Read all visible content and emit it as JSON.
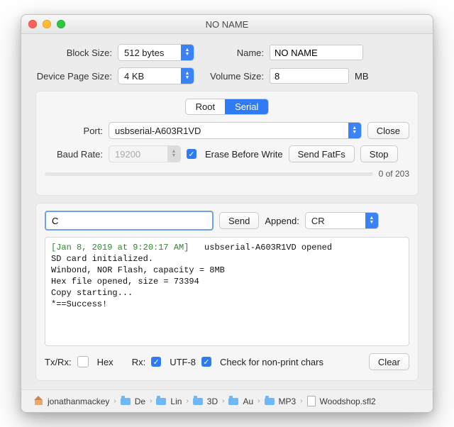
{
  "window": {
    "title": "NO NAME"
  },
  "settings": {
    "block_size_label": "Block Size:",
    "block_size_value": "512 bytes",
    "name_label": "Name:",
    "name_value": "NO NAME",
    "page_size_label": "Device Page Size:",
    "page_size_value": "4 KB",
    "volume_size_label": "Volume Size:",
    "volume_size_value": "8",
    "volume_size_unit": "MB"
  },
  "tabs": {
    "root": "Root",
    "serial": "Serial"
  },
  "port": {
    "label": "Port:",
    "value": "usbserial-A603R1VD",
    "close": "Close"
  },
  "baud": {
    "label": "Baud Rate:",
    "value": "19200",
    "erase_label": "Erase Before Write",
    "send_fatfs": "Send FatFs",
    "stop": "Stop"
  },
  "progress": {
    "text": "0 of 203"
  },
  "cmd": {
    "value": "C",
    "send": "Send",
    "append_label": "Append:",
    "append_value": "CR"
  },
  "log": {
    "timestamp": "[Jan 8, 2019 at 9:20:17 AM]",
    "opened": "usbserial-A603R1VD opened",
    "lines": "SD card initialized.\nWinbond, NOR Flash, capacity = 8MB\nHex file opened, size = 73394\nCopy starting...\n*==Success!"
  },
  "options": {
    "txrx_label": "Tx/Rx:",
    "hex_label": "Hex",
    "rx_label": "Rx:",
    "utf8_label": "UTF-8",
    "nonprint_label": "Check for non-print chars",
    "clear": "Clear"
  },
  "breadcrumbs": {
    "items": [
      "jonathanmackey",
      "De",
      "Lin",
      "3D",
      "Au",
      "MP3"
    ],
    "file": "Woodshop.sfl2"
  }
}
